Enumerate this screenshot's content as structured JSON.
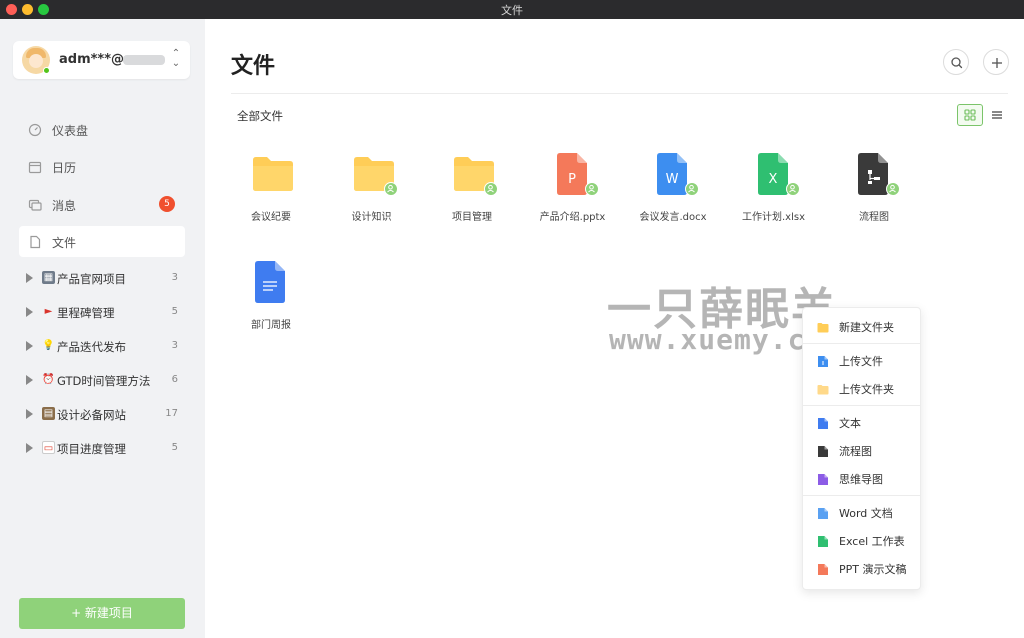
{
  "window": {
    "title": "文件"
  },
  "user": {
    "name": "adm***@"
  },
  "nav": [
    {
      "label": "仪表盘",
      "icon": "dashboard-icon"
    },
    {
      "label": "日历",
      "icon": "calendar-icon"
    },
    {
      "label": "消息",
      "icon": "message-icon",
      "badge": "5"
    },
    {
      "label": "文件",
      "icon": "file-icon",
      "active": true
    }
  ],
  "projects": [
    {
      "label": "产品官网项目",
      "count": "3",
      "icon": "building-icon"
    },
    {
      "label": "里程碑管理",
      "count": "5",
      "icon": "flag-icon"
    },
    {
      "label": "产品迭代发布",
      "count": "3",
      "icon": "lightbulb-icon"
    },
    {
      "label": "GTD时间管理方法",
      "count": "6",
      "icon": "alarm-clock-icon"
    },
    {
      "label": "设计必备网站",
      "count": "17",
      "icon": "inbox-icon"
    },
    {
      "label": "项目进度管理",
      "count": "5",
      "icon": "calendar-page-icon"
    }
  ],
  "new_project_label": "+  新建项目",
  "main": {
    "title": "文件",
    "breadcrumb": "全部文件",
    "files": [
      {
        "name": "会议纪要",
        "type": "folder",
        "shared": false
      },
      {
        "name": "设计知识",
        "type": "folder",
        "shared": true
      },
      {
        "name": "项目管理",
        "type": "folder",
        "shared": true
      },
      {
        "name": "产品介绍.pptx",
        "type": "pptx",
        "letter": "P",
        "shared": true
      },
      {
        "name": "会议发言.docx",
        "type": "docx",
        "letter": "W",
        "shared": true
      },
      {
        "name": "工作计划.xlsx",
        "type": "xlsx",
        "letter": "X",
        "shared": true
      },
      {
        "name": "流程图",
        "type": "flowchart",
        "shared": true
      },
      {
        "name": "部门周报",
        "type": "doc",
        "shared": false
      }
    ]
  },
  "watermark": {
    "line1": "一只薛眠羊",
    "line2": "www.xuemy.cn"
  },
  "menu": {
    "groups": [
      [
        {
          "label": "新建文件夹",
          "icon": "folder-icon"
        }
      ],
      [
        {
          "label": "上传文件",
          "icon": "upload-file-icon"
        },
        {
          "label": "上传文件夹",
          "icon": "upload-folder-icon"
        }
      ],
      [
        {
          "label": "文本",
          "icon": "text-doc-icon"
        },
        {
          "label": "流程图",
          "icon": "flowchart-icon"
        },
        {
          "label": "思维导图",
          "icon": "mindmap-icon"
        }
      ],
      [
        {
          "label": "Word 文档",
          "icon": "word-icon"
        },
        {
          "label": "Excel 工作表",
          "icon": "excel-icon"
        },
        {
          "label": "PPT 演示文稿",
          "icon": "ppt-icon"
        }
      ]
    ]
  },
  "colors": {
    "accent": "#8fd27a",
    "folder": "#ffcd57",
    "ppt": "#f4795a",
    "word": "#3d8ef0",
    "excel": "#2fbf71",
    "flowchart": "#3a3a3a",
    "doc": "#3f7cf0",
    "mindmap": "#8c5ce6",
    "badge": "#f0502e"
  }
}
